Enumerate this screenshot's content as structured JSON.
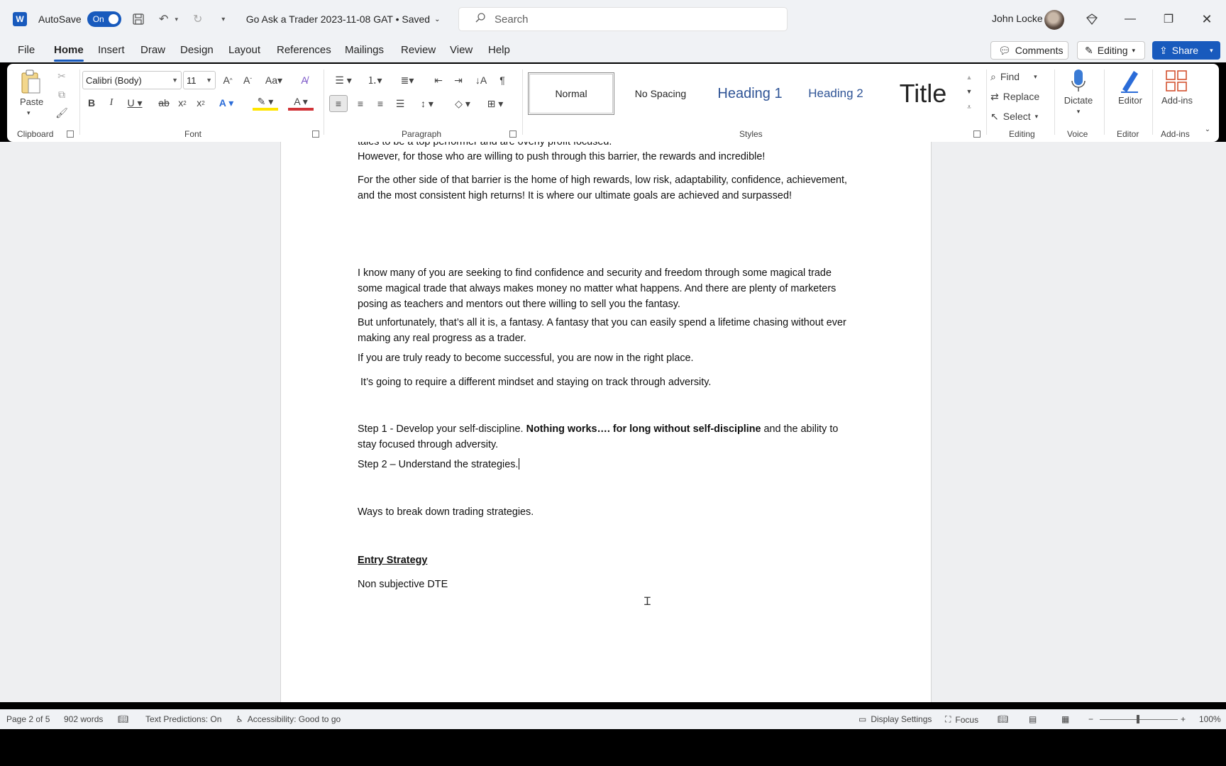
{
  "titlebar": {
    "app_logo": "W",
    "autosave_label": "AutoSave",
    "autosave_state": "On",
    "doc_title": "Go Ask a Trader 2023-11-08 GAT • Saved",
    "search_placeholder": "Search",
    "user_name": "John Locke"
  },
  "menu": {
    "items": [
      "File",
      "Home",
      "Insert",
      "Draw",
      "Design",
      "Layout",
      "References",
      "Mailings",
      "Review",
      "View",
      "Help"
    ],
    "comments_label": "Comments",
    "editing_label": "Editing",
    "share_label": "Share"
  },
  "ribbon": {
    "clipboard": {
      "paste_label": "Paste",
      "group_label": "Clipboard"
    },
    "font": {
      "font_name": "Calibri (Body)",
      "font_size": "11",
      "group_label": "Font"
    },
    "paragraph": {
      "group_label": "Paragraph"
    },
    "styles": {
      "items": [
        "Normal",
        "No Spacing",
        "Heading 1",
        "Heading 2",
        "Title"
      ],
      "group_label": "Styles"
    },
    "editing": {
      "find_label": "Find",
      "replace_label": "Replace",
      "select_label": "Select",
      "group_label": "Editing"
    },
    "voice": {
      "dictate_label": "Dictate",
      "group_label": "Voice"
    },
    "editor": {
      "editor_label": "Editor",
      "group_label": "Editor"
    },
    "addins": {
      "addins_label": "Add-ins",
      "group_label": "Add-ins"
    }
  },
  "document": {
    "p0": "tales to be a top performer and are overly profit focused.",
    "p1": "However, for those who are willing to push through this barrier, the rewards and incredible!",
    "p2": "For the other side of that barrier is the home of high rewards, low risk, adaptability, confidence, achievement, and the most consistent high returns!  It is where our ultimate goals are achieved and surpassed!",
    "p3": "I know many of you are seeking to find confidence and security and freedom through some magical trade some magical trade that always makes money no matter what happens. And there are plenty of marketers posing as teachers and mentors out there willing to sell you the fantasy.",
    "p4": "But unfortunately, that’s all it is, a fantasy. A fantasy that you can easily spend a lifetime chasing without ever making any real progress as a trader.",
    "p5": "If you are truly ready to become successful, you are now in the right place.",
    "p6": " It’s going to require a different mindset and staying on track through adversity.",
    "p7_a": "Step 1 - Develop your self-discipline. ",
    "p7_b": "Nothing works…. for long without self-discipline",
    "p7_c": " and the ability to stay focused through adversity.",
    "p8": "Step 2 – Understand the strategies.",
    "p9": "Ways to break down trading strategies.",
    "p10": "Entry Strategy",
    "p11": "Non subjective DTE"
  },
  "status": {
    "page": "Page 2 of 5",
    "words": "902 words",
    "predictions": "Text Predictions: On",
    "accessibility": "Accessibility: Good to go",
    "display_settings": "Display Settings",
    "focus": "Focus",
    "zoom": "100%"
  }
}
